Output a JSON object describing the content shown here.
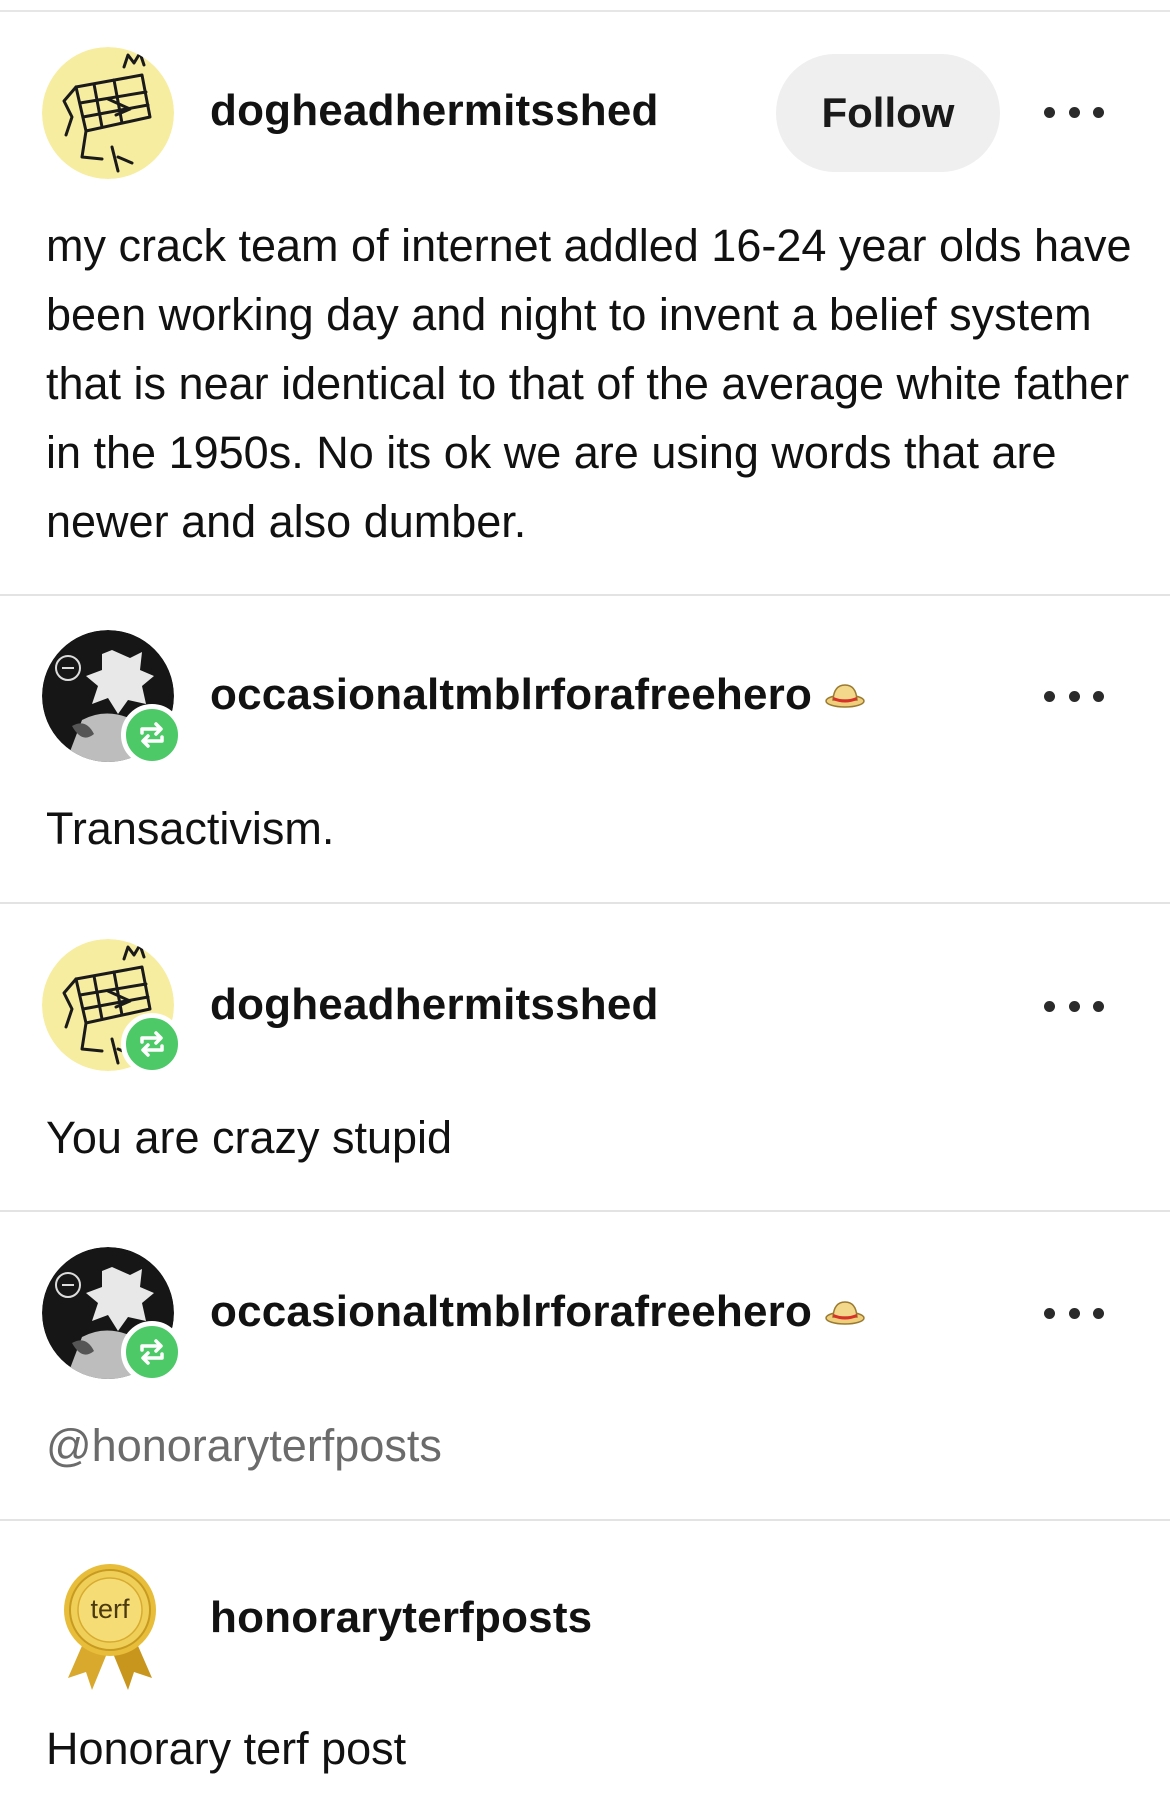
{
  "posts": [
    {
      "username": "dogheadhermitsshed",
      "follow_label": "Follow",
      "text": "my crack team of internet addled 16-24 year olds have been working day and night to invent a belief system that is near identical to that of the average white father in the 1950s. No its ok we are using words that are newer and also dumber.",
      "avatar": "doghead-avatar",
      "reblog": false
    },
    {
      "username": "occasionaltmblrforafreehero",
      "text": "Transactivism.",
      "avatar": "anime-avatar",
      "badge": "straw-hat-icon",
      "reblog": true
    },
    {
      "username": "dogheadhermitsshed",
      "text": "You are crazy stupid",
      "avatar": "doghead-avatar",
      "reblog": true
    },
    {
      "username": "occasionaltmblrforafreehero",
      "text": "@honoraryterfposts",
      "avatar": "anime-avatar",
      "badge": "straw-hat-icon",
      "reblog": true
    },
    {
      "username": "honoraryterfposts",
      "text": "Honorary terf post",
      "avatar": "terf-ribbon-avatar",
      "avatar_text": "terf",
      "reblog": false
    }
  ],
  "colors": {
    "reblog_green": "#4dc968",
    "follow_bg": "#efefef",
    "doghead_yellow": "#f7eda0",
    "mention_gray": "#6b6b6b"
  }
}
